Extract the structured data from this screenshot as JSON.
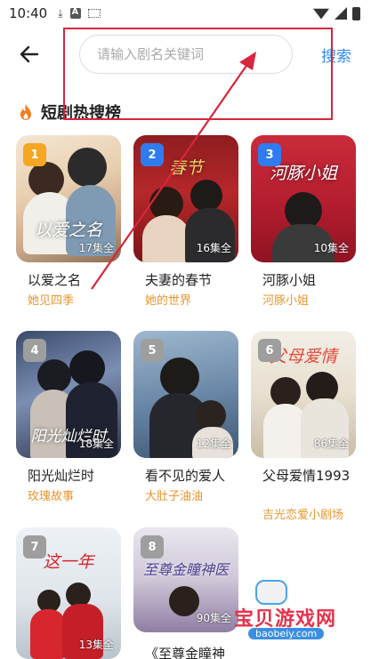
{
  "status_bar": {
    "time": "10:40"
  },
  "header": {
    "search_placeholder": "请输入剧名关键词",
    "search_value": "",
    "search_button": "搜索"
  },
  "section": {
    "title": "短剧热搜榜"
  },
  "rank_colors": {
    "top": "#f5a623",
    "blue": "#2f7bf0",
    "grey": "#9e9e9e"
  },
  "accent_color": "#2f8bf0",
  "subtitle_color": "#e8962e",
  "items": [
    {
      "rank": "1",
      "episodes": "17集全",
      "title": "以爱之名",
      "subtitle": "她见四季",
      "poster_caption": "以爱之名"
    },
    {
      "rank": "2",
      "episodes": "16集全",
      "title": "夫妻的春节",
      "subtitle": "她的世界",
      "poster_caption": "春节"
    },
    {
      "rank": "3",
      "episodes": "10集全",
      "title": "河豚小姐",
      "subtitle": "河豚小姐",
      "poster_caption": "河豚小姐"
    },
    {
      "rank": "4",
      "episodes": "18集全",
      "title": "阳光灿烂时",
      "subtitle": "玫瑰故事",
      "poster_caption": "阳光灿烂时"
    },
    {
      "rank": "5",
      "episodes": "12集全",
      "title": "看不见的爱人",
      "subtitle": "大肚子油油",
      "poster_caption": ""
    },
    {
      "rank": "6",
      "episodes": "86集全",
      "title": "父母爱情1993",
      "subtitle": "吉光恋爱小剧场",
      "poster_caption": "父母爱情"
    },
    {
      "rank": "7",
      "episodes": "13集全",
      "title": "",
      "subtitle": "",
      "poster_caption": "这一年"
    },
    {
      "rank": "8",
      "episodes": "90集全",
      "title": "《至尊金瞳神",
      "subtitle": "",
      "poster_caption": "至尊金瞳神医"
    }
  ],
  "watermark": {
    "text": "宝贝游戏网",
    "url": "baobeiy.com"
  }
}
